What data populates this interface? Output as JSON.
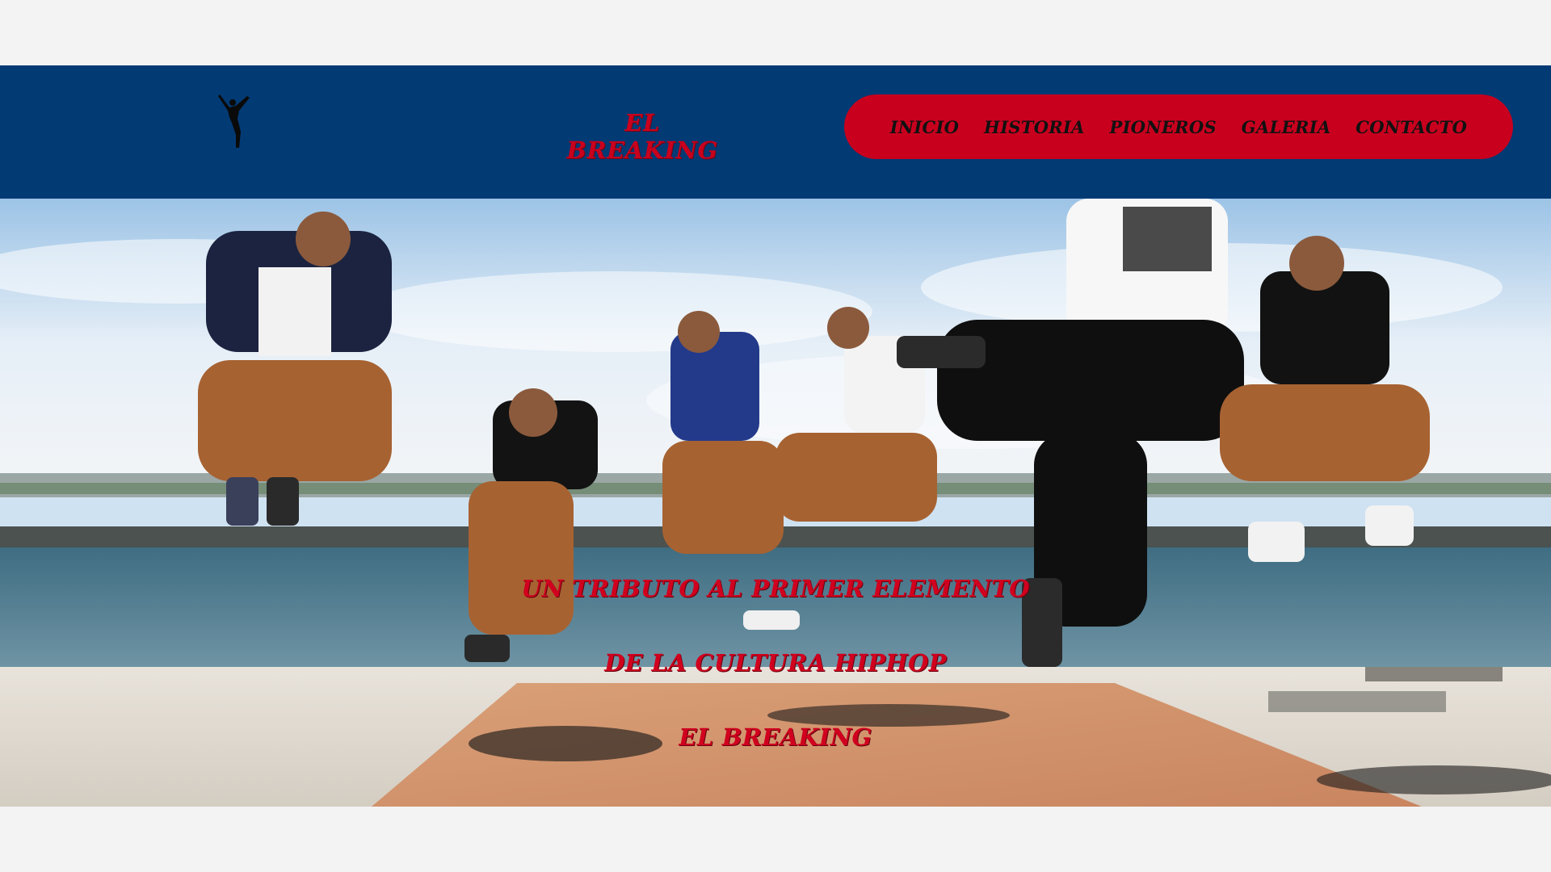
{
  "header": {
    "logo_icon": "breakdancer-silhouette-icon",
    "brand": "EL BREAKING",
    "nav": [
      {
        "label": "INICIO"
      },
      {
        "label": "HISTORIA"
      },
      {
        "label": "PIONEROS"
      },
      {
        "label": "GALERIA"
      },
      {
        "label": "CONTACTO"
      }
    ]
  },
  "hero": {
    "lines": [
      "UN TRIBUTO AL PRIMER ELEMENTO",
      "DE LA CULTURA HIPHOP",
      "EL BREAKING"
    ]
  },
  "colors": {
    "header_bg": "#023a74",
    "accent_red": "#c8001e",
    "page_bg": "#f3f3f3"
  }
}
